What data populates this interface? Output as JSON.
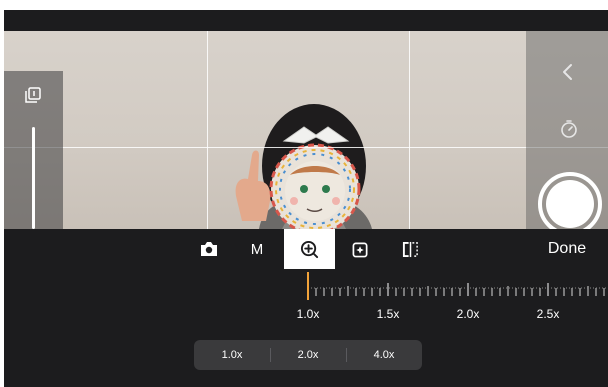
{
  "toolbar": {
    "icons": [
      "camera-icon",
      "mode-m",
      "zoom-plus-icon",
      "sparkle-photo-icon",
      "split-view-icon"
    ],
    "mode_label": "M",
    "done_label": "Done"
  },
  "zoom": {
    "ruler_labels": [
      "1.0x",
      "1.5x",
      "2.0x",
      "2.5x"
    ],
    "current_level": 1.0,
    "presets": [
      "1.0x",
      "2.0x",
      "4.0x"
    ]
  },
  "colors": {
    "background": "#1c1c1e",
    "indicator": "#f2a33a",
    "preset_bg": "#3a3a3c"
  }
}
